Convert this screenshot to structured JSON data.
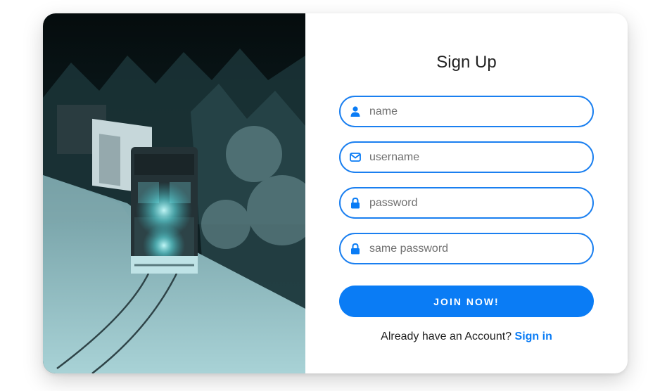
{
  "form": {
    "title": "Sign Up",
    "fields": [
      {
        "icon": "user-icon",
        "placeholder": "name"
      },
      {
        "icon": "envelope-icon",
        "placeholder": "username"
      },
      {
        "icon": "lock-icon",
        "placeholder": "password"
      },
      {
        "icon": "lock-icon",
        "placeholder": "same password"
      }
    ],
    "submit_label": "JOIN NOW!",
    "footer_text": "Already have an Account?",
    "signin_link": "Sign in"
  },
  "colors": {
    "accent": "#0a7cf5",
    "field_border": "#1a7ff0",
    "title_text": "#222222"
  }
}
